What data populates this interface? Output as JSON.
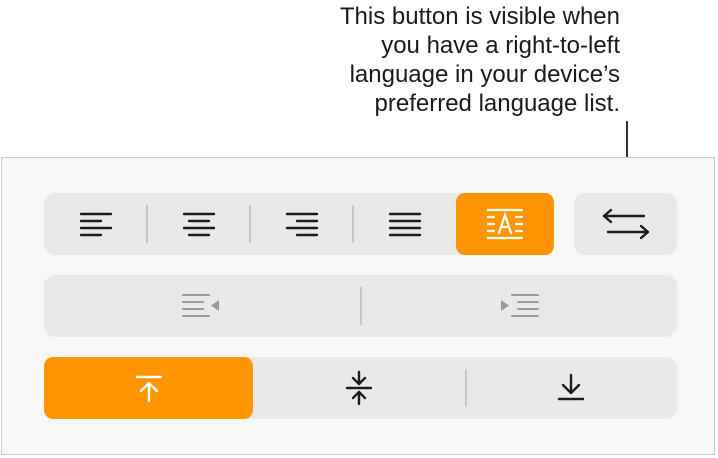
{
  "callout": {
    "lines": [
      "This button is visible when",
      "you have a right-to-left",
      "language in your device’s",
      "preferred language list."
    ]
  },
  "toolbar": {
    "alignment_buttons": [
      "align-left",
      "align-center",
      "align-right",
      "justify",
      "auto-align"
    ],
    "active_alignment": "auto-align",
    "direction_button": "text-direction",
    "indent_buttons": [
      "decrease-indent",
      "increase-indent"
    ],
    "vertical_buttons": [
      "align-top",
      "align-middle",
      "align-bottom"
    ],
    "active_vertical": "align-top"
  },
  "colors": {
    "accent": "#ff9500",
    "segment_bg": "#e9e9e9",
    "panel_bg": "#f7f7f7",
    "icon": "#1c1c1c",
    "icon_disabled": "#9a9a9a"
  }
}
